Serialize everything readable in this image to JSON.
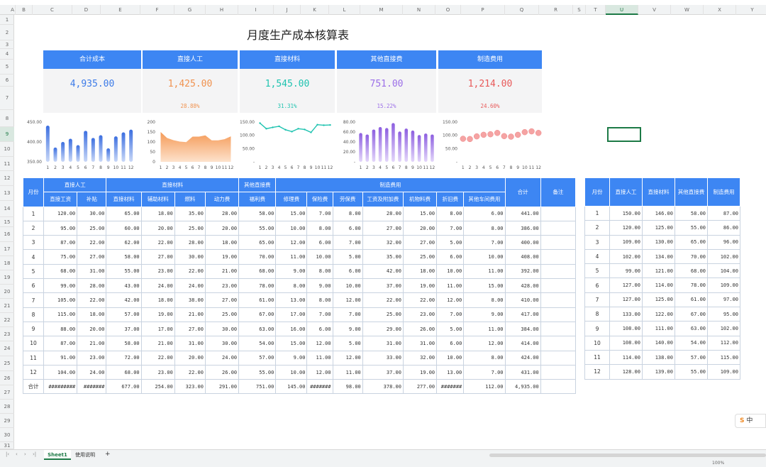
{
  "title": "月度生产成本核算表",
  "columns": [
    "A",
    "B",
    "C",
    "D",
    "E",
    "F",
    "G",
    "H",
    "I",
    "J",
    "K",
    "L",
    "M",
    "N",
    "O",
    "P",
    "Q",
    "R",
    "S",
    "T",
    "U",
    "V",
    "W",
    "X",
    "Y"
  ],
  "rows": [
    "1",
    "2",
    "3",
    "4",
    "5",
    "6",
    "7",
    "8",
    "9",
    "10",
    "11",
    "12",
    "13",
    "14",
    "15",
    "16",
    "17",
    "18",
    "19",
    "20",
    "21",
    "22",
    "23",
    "24",
    "25",
    "26",
    "27",
    "28",
    "29",
    "30",
    "31"
  ],
  "cards": [
    {
      "label": "合计成本",
      "value": "4,935.00",
      "pct": "",
      "color": "#3d7be8"
    },
    {
      "label": "直接人工",
      "value": "1,425.00",
      "pct": "28.88%",
      "color": "#f0924f"
    },
    {
      "label": "直接材料",
      "value": "1,545.00",
      "pct": "31.31%",
      "color": "#1fc3b0"
    },
    {
      "label": "其他直接费",
      "value": "751.00",
      "pct": "15.22%",
      "color": "#9b6ee8"
    },
    {
      "label": "制造费用",
      "value": "1,214.00",
      "pct": "24.60%",
      "color": "#e85a5a"
    }
  ],
  "chart_data": [
    {
      "type": "bar",
      "x": [
        "1",
        "2",
        "3",
        "4",
        "5",
        "6",
        "7",
        "8",
        "9",
        "10",
        "11",
        "12"
      ],
      "values": [
        441,
        386,
        400,
        408,
        392,
        428,
        410,
        417,
        384,
        414,
        424,
        431
      ],
      "ylim": [
        350,
        450
      ],
      "yticks": [
        "450.00",
        "400.00",
        "350.00"
      ]
    },
    {
      "type": "area",
      "x": [
        "1",
        "2",
        "3",
        "4",
        "5",
        "6",
        "7",
        "8",
        "9",
        "10",
        "11",
        "12"
      ],
      "values": [
        150,
        120,
        109,
        102,
        99,
        127,
        127,
        133,
        108,
        108,
        114,
        128
      ],
      "ylim": [
        0,
        200
      ],
      "yticks": [
        "200",
        "150",
        "100",
        "50",
        "0"
      ]
    },
    {
      "type": "line",
      "x": [
        "1",
        "2",
        "3",
        "4",
        "5",
        "6",
        "7",
        "8",
        "9",
        "10",
        "11",
        "12"
      ],
      "values": [
        146,
        125,
        130,
        134,
        121,
        114,
        125,
        122,
        111,
        140,
        138,
        139
      ],
      "ylim": [
        0,
        150
      ],
      "yticks": [
        "150.00",
        "100.00",
        "50.00",
        "-"
      ]
    },
    {
      "type": "bar",
      "x": [
        "1",
        "2",
        "3",
        "4",
        "5",
        "6",
        "7",
        "8",
        "9",
        "10",
        "11",
        "12"
      ],
      "values": [
        58,
        55,
        65,
        70,
        68,
        78,
        61,
        67,
        63,
        54,
        57,
        55
      ],
      "ylim": [
        0,
        80
      ],
      "yticks": [
        "80.00",
        "60.00",
        "40.00",
        "20.00",
        "-"
      ]
    },
    {
      "type": "scatter",
      "x": [
        "1",
        "2",
        "3",
        "4",
        "5",
        "6",
        "7",
        "8",
        "9",
        "10",
        "11",
        "12"
      ],
      "values": [
        87,
        86,
        96,
        102,
        104,
        109,
        97,
        95,
        102,
        112,
        115,
        109
      ],
      "ylim": [
        0,
        150
      ],
      "yticks": [
        "150.00",
        "100.00",
        "50.00",
        "-"
      ]
    }
  ],
  "main_table": {
    "group_headers": [
      "月份",
      "直接人工",
      "直接材料",
      "其他直接费",
      "制造费用",
      "合计",
      "备注"
    ],
    "sub_headers": [
      "直接工资",
      "补贴",
      "直接材料",
      "辅助材料",
      "燃料",
      "动力费",
      "福利费",
      "修理费",
      "保险费",
      "劳保费",
      "工资及附加费",
      "机物料费",
      "折旧费",
      "其他车间费用"
    ],
    "rows": [
      [
        "1",
        "120.00",
        "30.00",
        "65.00",
        "18.00",
        "35.00",
        "28.00",
        "58.00",
        "15.00",
        "7.00",
        "8.00",
        "28.00",
        "15.00",
        "8.00",
        "6.00",
        "441.00",
        ""
      ],
      [
        "2",
        "95.00",
        "25.00",
        "60.00",
        "20.00",
        "25.00",
        "20.00",
        "55.00",
        "10.00",
        "8.00",
        "6.00",
        "27.00",
        "20.00",
        "7.00",
        "8.00",
        "386.00",
        ""
      ],
      [
        "3",
        "87.00",
        "22.00",
        "62.00",
        "22.00",
        "28.00",
        "18.00",
        "65.00",
        "12.00",
        "6.00",
        "7.00",
        "32.00",
        "27.00",
        "5.00",
        "7.00",
        "400.00",
        ""
      ],
      [
        "4",
        "75.00",
        "27.00",
        "58.00",
        "27.00",
        "30.00",
        "19.00",
        "70.00",
        "11.00",
        "10.00",
        "5.00",
        "35.00",
        "25.00",
        "6.00",
        "10.00",
        "408.00",
        ""
      ],
      [
        "5",
        "68.00",
        "31.00",
        "55.00",
        "23.00",
        "22.00",
        "21.00",
        "68.00",
        "9.00",
        "8.00",
        "6.00",
        "42.00",
        "18.00",
        "10.00",
        "11.00",
        "392.00",
        ""
      ],
      [
        "6",
        "99.00",
        "28.00",
        "43.00",
        "24.00",
        "24.00",
        "23.00",
        "78.00",
        "8.00",
        "9.00",
        "10.00",
        "37.00",
        "19.00",
        "11.00",
        "15.00",
        "428.00",
        ""
      ],
      [
        "7",
        "105.00",
        "22.00",
        "42.00",
        "18.00",
        "38.00",
        "27.00",
        "61.00",
        "13.00",
        "8.00",
        "12.00",
        "22.00",
        "22.00",
        "12.00",
        "8.00",
        "410.00",
        ""
      ],
      [
        "8",
        "115.00",
        "18.00",
        "57.00",
        "19.00",
        "21.00",
        "25.00",
        "67.00",
        "17.00",
        "7.00",
        "7.00",
        "25.00",
        "23.00",
        "7.00",
        "9.00",
        "417.00",
        ""
      ],
      [
        "9",
        "88.00",
        "20.00",
        "37.00",
        "17.00",
        "27.00",
        "30.00",
        "63.00",
        "16.00",
        "6.00",
        "9.00",
        "29.00",
        "26.00",
        "5.00",
        "11.00",
        "384.00",
        ""
      ],
      [
        "10",
        "87.00",
        "21.00",
        "58.00",
        "21.00",
        "31.00",
        "30.00",
        "54.00",
        "15.00",
        "12.00",
        "5.00",
        "31.00",
        "31.00",
        "6.00",
        "12.00",
        "414.00",
        ""
      ],
      [
        "11",
        "91.00",
        "23.00",
        "72.00",
        "22.00",
        "20.00",
        "24.00",
        "57.00",
        "9.00",
        "11.00",
        "12.00",
        "33.00",
        "32.00",
        "10.00",
        "8.00",
        "424.00",
        ""
      ],
      [
        "12",
        "104.00",
        "24.00",
        "68.00",
        "23.00",
        "22.00",
        "26.00",
        "55.00",
        "10.00",
        "12.00",
        "11.00",
        "37.00",
        "19.00",
        "13.00",
        "7.00",
        "431.00",
        ""
      ]
    ],
    "total_row": [
      "合计",
      "#########",
      "#######",
      "677.00",
      "254.00",
      "323.00",
      "291.00",
      "751.00",
      "145.00",
      "#######",
      "98.00",
      "378.00",
      "277.00",
      "#######",
      "112.00",
      "4,935.00",
      ""
    ]
  },
  "side_table": {
    "headers": [
      "月份",
      "直接人工",
      "直接材料",
      "其他直接费",
      "制造费用"
    ],
    "rows": [
      [
        "1",
        "150.00",
        "146.00",
        "58.00",
        "87.00"
      ],
      [
        "2",
        "120.00",
        "125.00",
        "55.00",
        "86.00"
      ],
      [
        "3",
        "109.00",
        "130.00",
        "65.00",
        "96.00"
      ],
      [
        "4",
        "102.00",
        "134.00",
        "70.00",
        "102.00"
      ],
      [
        "5",
        "99.00",
        "121.00",
        "68.00",
        "104.00"
      ],
      [
        "6",
        "127.00",
        "114.00",
        "78.00",
        "109.00"
      ],
      [
        "7",
        "127.00",
        "125.00",
        "61.00",
        "97.00"
      ],
      [
        "8",
        "133.00",
        "122.00",
        "67.00",
        "95.00"
      ],
      [
        "9",
        "108.00",
        "111.00",
        "63.00",
        "102.00"
      ],
      [
        "10",
        "108.00",
        "140.00",
        "54.00",
        "112.00"
      ],
      [
        "11",
        "114.00",
        "138.00",
        "57.00",
        "115.00"
      ],
      [
        "12",
        "128.00",
        "139.00",
        "55.00",
        "109.00"
      ]
    ]
  },
  "tabs": {
    "sheet1": "Sheet1",
    "help": "使用说明",
    "add": "+"
  },
  "ime": {
    "s": "S",
    "lang": "中"
  },
  "status": {
    "zoom": "100%"
  }
}
